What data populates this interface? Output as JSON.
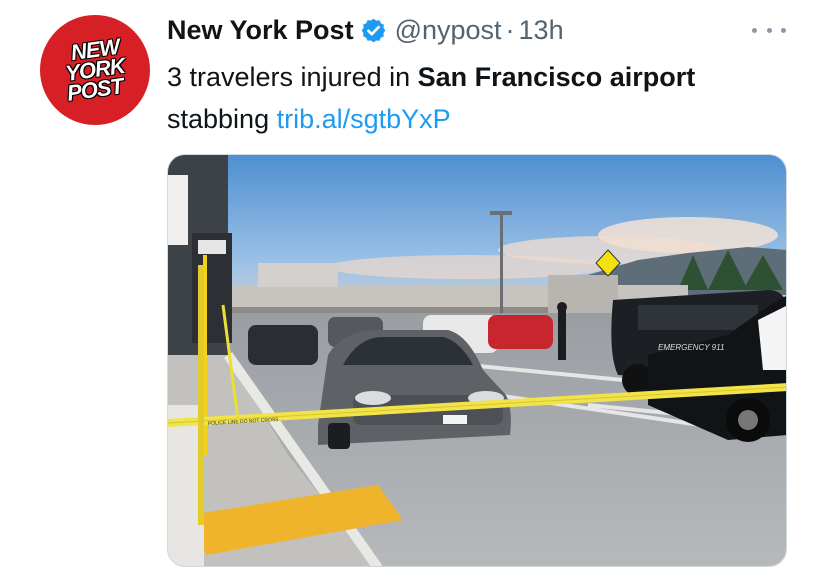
{
  "tweet": {
    "author_name": "New York Post",
    "handle": "@nypost",
    "separator": "·",
    "time": "13h",
    "text_pre": "3 travelers injured in ",
    "text_bold": "San Francisco airport",
    "text_post": " stabbing ",
    "link": "trib.al/sgtbYxP",
    "avatar_logo": [
      "NEW",
      "YORK",
      "POST"
    ]
  },
  "media": {
    "police_tape_text": "POLICE LINE DO NOT CROSS",
    "vehicle_label": "EMERGENCY 911"
  },
  "icons": {
    "verified": "verified-badge-icon",
    "more": "more-icon"
  },
  "colors": {
    "brand_red": "#d71f26",
    "link_blue": "#1d9bf0",
    "verified_blue": "#1d9bf0",
    "secondary_text": "#536471"
  }
}
